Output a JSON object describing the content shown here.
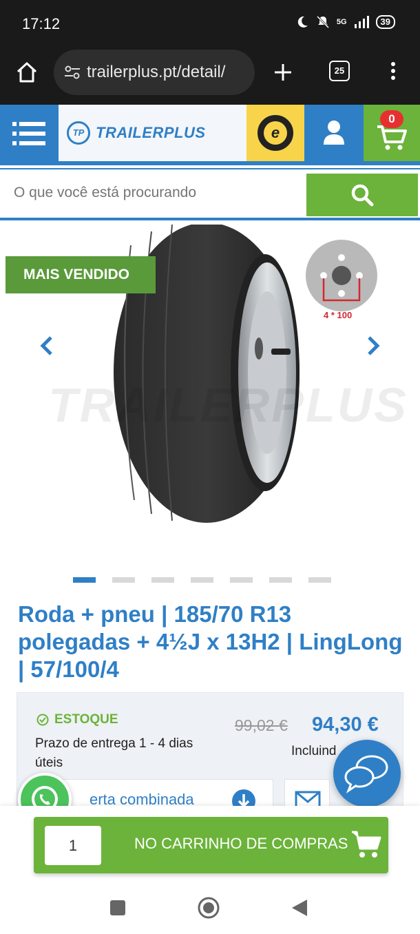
{
  "status_bar": {
    "time": "17:12",
    "network": "5G",
    "battery": "39"
  },
  "browser": {
    "url": "trailerplus.pt/detail/",
    "tab_count": "25"
  },
  "header": {
    "logo_text": "TRAILERPLUS",
    "logo_mark": "TP",
    "cart_count": "0",
    "trusted_badge": "e"
  },
  "search": {
    "placeholder": "O que você está procurando"
  },
  "gallery": {
    "badge": "MAIS VENDIDO",
    "bolt_pattern": "4 * 100",
    "watermark": "TRAILERPLUS",
    "slide_count": 7,
    "active_slide": 1
  },
  "product": {
    "title": "Roda + pneu | 185/70 R13 polegadas + 4½J x 13H2 | LingLong | 57/100/4",
    "stock_label": "ESTOQUE",
    "delivery": "Prazo de entrega 1 - 4 dias úteis",
    "old_price": "99,02 €",
    "price": "94,30 €",
    "included": "Incluind",
    "combo_text": "erta combinada"
  },
  "cart_bar": {
    "quantity": "1",
    "add_label": "NO CARRINHO DE COMPRAS"
  },
  "colors": {
    "brand_blue": "#2f7fc6",
    "brand_green": "#6bb33a",
    "badge_green": "#5a9a3a",
    "cart_badge": "#e63030"
  }
}
